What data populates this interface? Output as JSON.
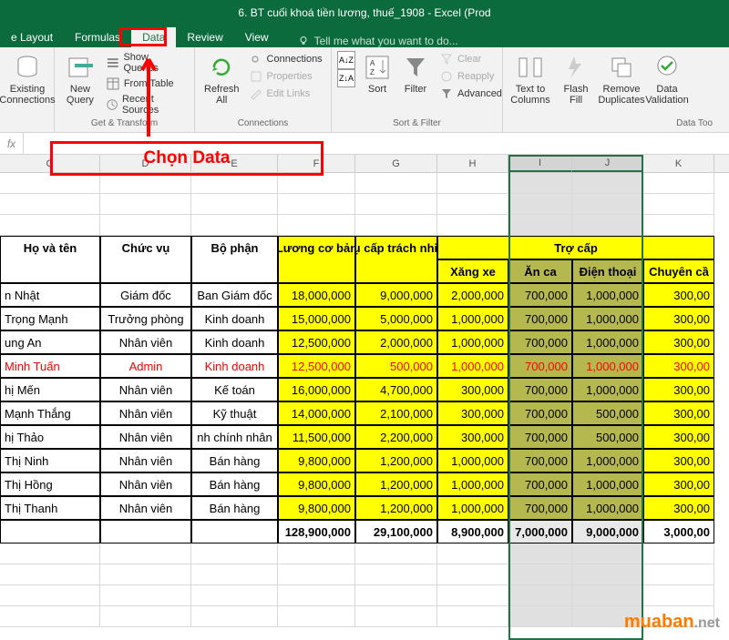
{
  "title": "6. BT cuối khoá tiền lương, thuế_1908 - Excel (Prod",
  "tabs": {
    "layout": "e Layout",
    "formulas": "Formulas",
    "data": "Data",
    "review": "Review",
    "view": "View",
    "tellme": "Tell me what you want to do..."
  },
  "ribbon": {
    "existing": "Existing\nConnections",
    "newquery": "New\nQuery",
    "showq": "Show Queries",
    "fromtable": "From Table",
    "recent": "Recent Sources",
    "gt_label": "Get & Transform",
    "refresh": "Refresh\nAll",
    "conns": "Connections",
    "props": "Properties",
    "edit": "Edit Links",
    "conn_label": "Connections",
    "sort": "Sort",
    "filter": "Filter",
    "clear": "Clear",
    "reapply": "Reapply",
    "advanced": "Advanced",
    "sf_label": "Sort & Filter",
    "t2c": "Text to\nColumns",
    "flash": "Flash\nFill",
    "remove": "Remove\nDuplicates",
    "datav": "Data\nValidation",
    "dt_label": "Data Too"
  },
  "fx": "fx",
  "annot": "Chọn Data",
  "cols": {
    "c": "C",
    "d": "D",
    "e": "E",
    "f": "F",
    "g": "G",
    "h": "H",
    "i": "I",
    "j": "J",
    "k": "K"
  },
  "headers": {
    "hoten": "Họ và tên",
    "chucvu": "Chức vụ",
    "bophan": "Bộ phận",
    "luong": "Lương cơ bản",
    "phucap": "Phụ cấp trách nhiệm",
    "trocap": "Trợ cấp",
    "xangxe": "Xăng xe",
    "anca": "Ăn ca",
    "dienthoai": "Điện thoại",
    "chuyen": "Chuyên cầ"
  },
  "data": [
    {
      "name": "n Nhật",
      "cv": "Giám đốc",
      "bp": "Ban Giám đốc",
      "l": "18,000,000",
      "p": "9,000,000",
      "x": "2,000,000",
      "a": "700,000",
      "d": "1,000,000",
      "c": "300,00",
      "red": false
    },
    {
      "name": "Trọng Mạnh",
      "cv": "Trưởng phòng",
      "bp": "Kinh doanh",
      "l": "15,000,000",
      "p": "5,000,000",
      "x": "1,000,000",
      "a": "700,000",
      "d": "1,000,000",
      "c": "300,00",
      "red": false
    },
    {
      "name": "ung An",
      "cv": "Nhân viên",
      "bp": "Kinh doanh",
      "l": "12,500,000",
      "p": "2,000,000",
      "x": "1,000,000",
      "a": "700,000",
      "d": "1,000,000",
      "c": "300,00",
      "red": false
    },
    {
      "name": "Minh Tuấn",
      "cv": "Admin",
      "bp": "Kinh doanh",
      "l": "12,500,000",
      "p": "500,000",
      "x": "1,000,000",
      "a": "700,000",
      "d": "1,000,000",
      "c": "300,00",
      "red": true
    },
    {
      "name": "hị Mến",
      "cv": "Nhân viên",
      "bp": "Kế toán",
      "l": "16,000,000",
      "p": "4,700,000",
      "x": "300,000",
      "a": "700,000",
      "d": "1,000,000",
      "c": "300,00",
      "red": false
    },
    {
      "name": "Mạnh Thắng",
      "cv": "Nhân viên",
      "bp": "Kỹ thuật",
      "l": "14,000,000",
      "p": "2,100,000",
      "x": "300,000",
      "a": "700,000",
      "d": "500,000",
      "c": "300,00",
      "red": false
    },
    {
      "name": "hị Thảo",
      "cv": "Nhân viên",
      "bp": "nh chính nhân",
      "l": "11,500,000",
      "p": "2,200,000",
      "x": "300,000",
      "a": "700,000",
      "d": "500,000",
      "c": "300,00",
      "red": false
    },
    {
      "name": "Thị Ninh",
      "cv": "Nhân viên",
      "bp": "Bán hàng",
      "l": "9,800,000",
      "p": "1,200,000",
      "x": "1,000,000",
      "a": "700,000",
      "d": "1,000,000",
      "c": "300,00",
      "red": false
    },
    {
      "name": "Thị Hồng",
      "cv": "Nhân viên",
      "bp": "Bán hàng",
      "l": "9,800,000",
      "p": "1,200,000",
      "x": "1,000,000",
      "a": "700,000",
      "d": "1,000,000",
      "c": "300,00",
      "red": false
    },
    {
      "name": "Thị Thanh",
      "cv": "Nhân viên",
      "bp": "Bán hàng",
      "l": "9,800,000",
      "p": "1,200,000",
      "x": "1,000,000",
      "a": "700,000",
      "d": "1,000,000",
      "c": "300,00",
      "red": false
    }
  ],
  "totals": {
    "l": "128,900,000",
    "p": "29,100,000",
    "x": "8,900,000",
    "a": "7,000,000",
    "d": "9,000,000",
    "c": "3,000,00"
  },
  "watermark": {
    "a": "muaban",
    "b": ".net"
  }
}
